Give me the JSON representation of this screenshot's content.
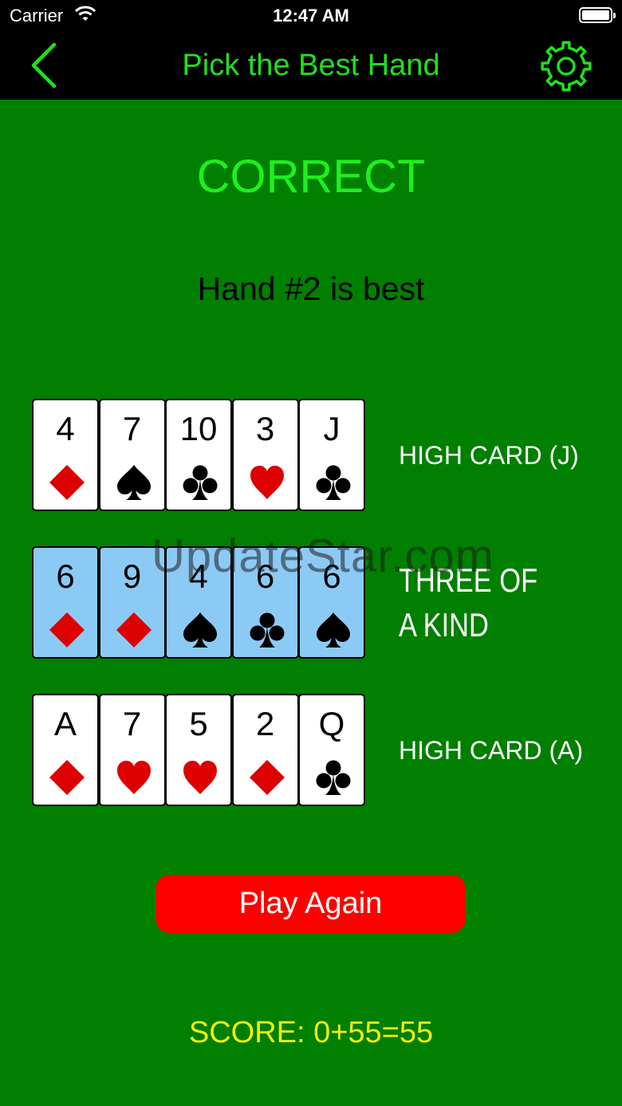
{
  "status_bar": {
    "carrier": "Carrier",
    "time": "12:47 AM"
  },
  "nav": {
    "title": "Pick the Best Hand",
    "back_icon": "chevron-left-icon",
    "settings_icon": "gear-icon"
  },
  "colors": {
    "felt": "#007f00",
    "accent_green": "#1ee01e",
    "diamond_heart": "#dd0000",
    "highlight": "#8ccaf6",
    "button": "#ff0000",
    "score": "#eeee10"
  },
  "result": {
    "headline": "CORRECT",
    "message": "Hand #2 is best"
  },
  "hands": [
    {
      "label": "HIGH CARD (J)",
      "highlighted": false,
      "cards": [
        {
          "rank": "4",
          "suit": "diamond"
        },
        {
          "rank": "7",
          "suit": "spade"
        },
        {
          "rank": "10",
          "suit": "club"
        },
        {
          "rank": "3",
          "suit": "heart"
        },
        {
          "rank": "J",
          "suit": "club"
        }
      ]
    },
    {
      "label": "THREE OF A KIND",
      "highlighted": true,
      "cards": [
        {
          "rank": "6",
          "suit": "diamond"
        },
        {
          "rank": "9",
          "suit": "diamond"
        },
        {
          "rank": "4",
          "suit": "spade"
        },
        {
          "rank": "6",
          "suit": "club"
        },
        {
          "rank": "6",
          "suit": "spade"
        }
      ]
    },
    {
      "label": "HIGH CARD (A)",
      "highlighted": false,
      "cards": [
        {
          "rank": "A",
          "suit": "diamond"
        },
        {
          "rank": "7",
          "suit": "heart"
        },
        {
          "rank": "5",
          "suit": "heart"
        },
        {
          "rank": "2",
          "suit": "diamond"
        },
        {
          "rank": "Q",
          "suit": "club"
        }
      ]
    }
  ],
  "watermark": "UpdateStar.com",
  "play_again": {
    "label": "Play Again"
  },
  "score": {
    "text": "SCORE: 0+55=55"
  }
}
